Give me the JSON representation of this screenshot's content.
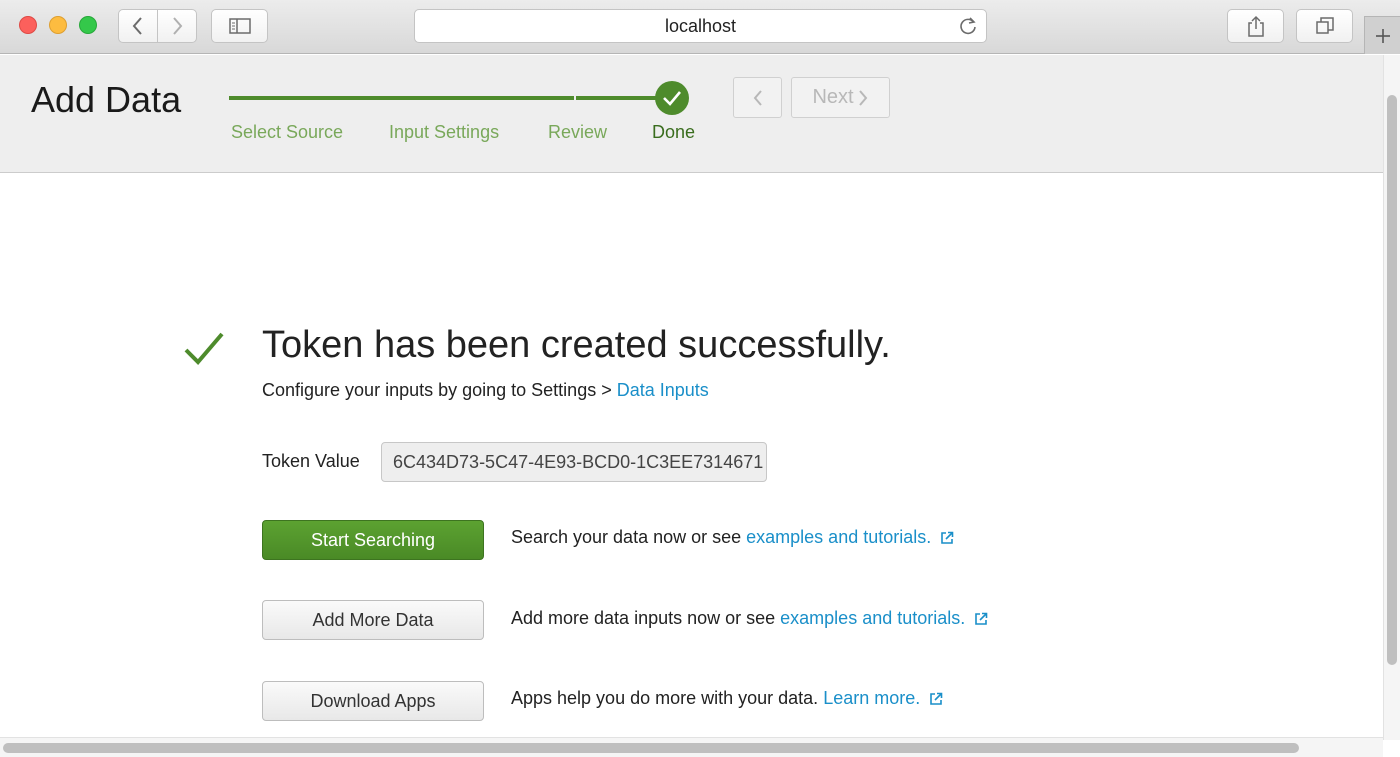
{
  "browser": {
    "url": "localhost",
    "icons": {
      "back": "chevron-left-icon",
      "forward": "chevron-right-icon",
      "sidebar": "sidebar-icon",
      "reload": "reload-icon",
      "share": "share-icon",
      "tabs": "tabs-icon",
      "new_tab": "plus-icon"
    }
  },
  "header": {
    "title": "Add Data",
    "steps": [
      {
        "label": "Select Source",
        "state": "complete"
      },
      {
        "label": "Input Settings",
        "state": "complete"
      },
      {
        "label": "Review",
        "state": "complete"
      },
      {
        "label": "Done",
        "state": "current"
      }
    ],
    "back_icon": "chevron-left-icon",
    "next_label": "Next",
    "next_icon": "chevron-right-icon"
  },
  "main": {
    "headline": "Token has been created successfully.",
    "subline_prefix": "Configure your inputs by going to Settings > ",
    "subline_link": "Data Inputs",
    "token_label": "Token Value",
    "token_value": "6C434D73-5C47-4E93-BCD0-1C3EE7314671",
    "actions": [
      {
        "button": "Start Searching",
        "style": "primary",
        "desc": "Search your data now or see ",
        "link": "examples and tutorials."
      },
      {
        "button": "Add More Data",
        "style": "default",
        "desc": "Add more data inputs now or see ",
        "link": "examples and tutorials."
      },
      {
        "button": "Download Apps",
        "style": "default",
        "desc": "Apps help you do more with your data. ",
        "link": "Learn more."
      }
    ]
  },
  "colors": {
    "accent_green": "#4e8b2c",
    "step_label_green": "#79a85a",
    "link_blue": "#1a8fc9"
  }
}
